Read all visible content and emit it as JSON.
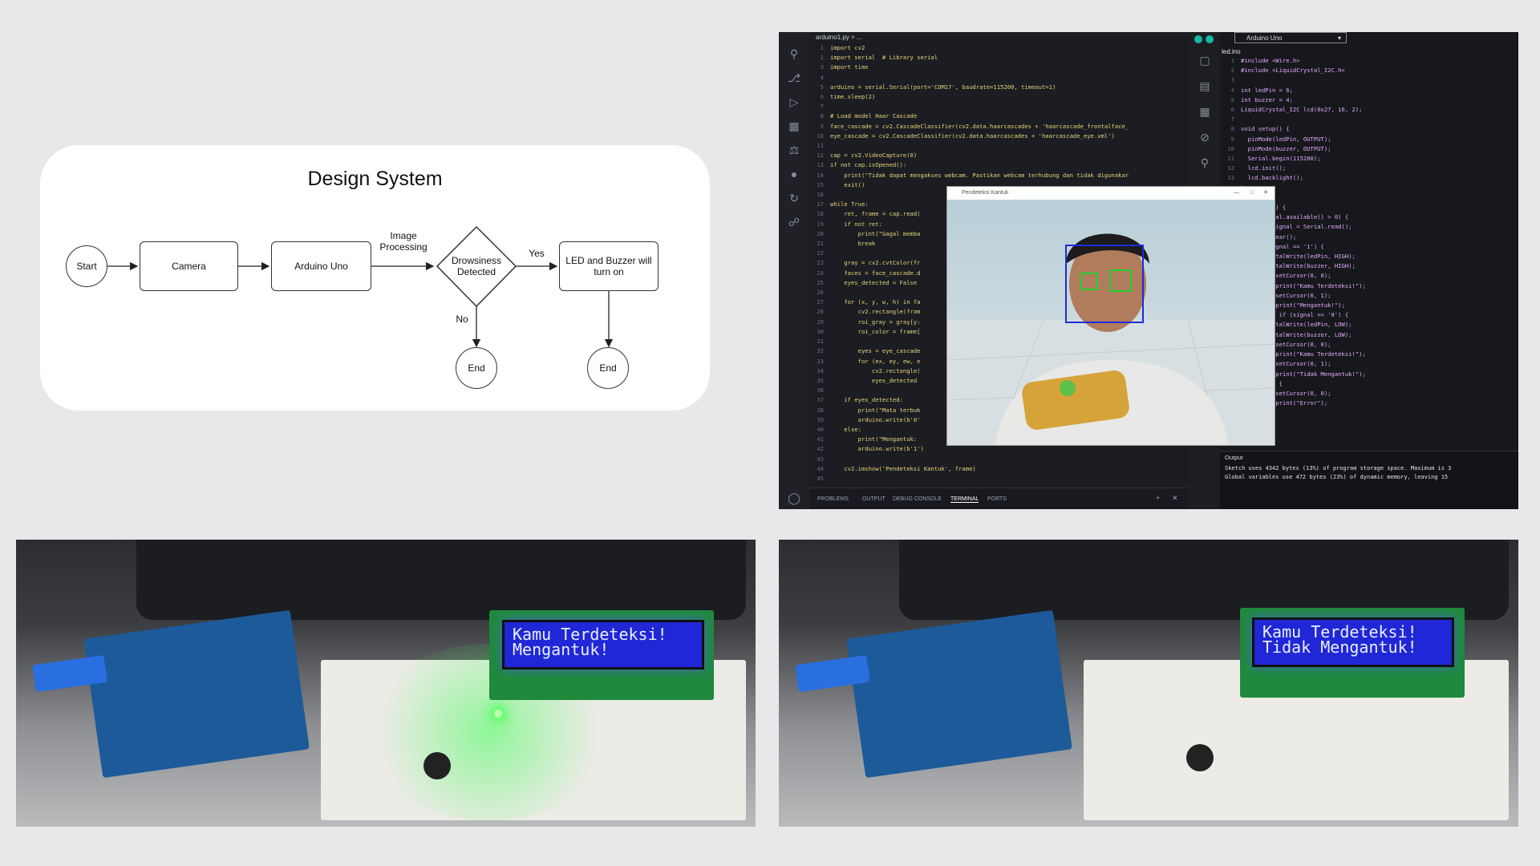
{
  "design": {
    "title": "Design System",
    "nodes": {
      "start": "Start",
      "camera": "Camera",
      "arduino": "Arduino Uno",
      "decision": "Drowsiness Detected",
      "action": "LED and Buzzer will turn on",
      "end1": "End",
      "end2": "End"
    },
    "labels": {
      "image_processing": "Image Processing",
      "yes": "Yes",
      "no": "No"
    }
  },
  "ide": {
    "python_tab": "arduino1.py > ...",
    "python_code": [
      "import cv2",
      "import serial  # Library serial",
      "import time",
      "",
      "arduino = serial.Serial(port='COM17', baudrate=115200, timeout=1)",
      "time.sleep(2)",
      "",
      "# Load model Haar Cascade",
      "face_cascade = cv2.CascadeClassifier(cv2.data.haarcascades + 'haarcascade_frontalface_",
      "eye_cascade = cv2.CascadeClassifier(cv2.data.haarcascades + 'haarcascade_eye.xml')",
      "",
      "cap = cv2.VideoCapture(0)",
      "if not cap.isOpened():",
      "    print(\"Tidak dapat mengakses webcam. Pastikan webcam terhubung dan tidak digunakar",
      "    exit()",
      "",
      "while True:",
      "    ret, frame = cap.read(",
      "    if not ret:",
      "        print(\"Gagal memba",
      "        break",
      "",
      "    gray = cv2.cvtColor(fr",
      "    faces = face_cascade.d",
      "    eyes_detected = False",
      "",
      "    for (x, y, w, h) in fa",
      "        cv2.rectangle(fram",
      "        roi_gray = gray[y:",
      "        roi_color = frame[",
      "",
      "        eyes = eye_cascade",
      "        for (ex, ey, ew, e",
      "            cv2.rectangle(",
      "            eyes_detected",
      "",
      "    if eyes_detected:",
      "        print(\"Mata terbuk",
      "        arduino.write(b'0'",
      "    else:",
      "        print(\"Mengantuk:",
      "        arduino.write(b'1')",
      "",
      "    cv2.imshow('Pendeteksi Kantuk', frame)",
      ""
    ],
    "bottom_tabs": [
      "PROBLEMS",
      "OUTPUT",
      "DEBUG CONSOLE",
      "TERMINAL",
      "PORTS"
    ],
    "board_select": "Arduino Uno",
    "ino_tab": "led.ino",
    "ino_code": [
      "#include <Wire.h>",
      "#include <LiquidCrystal_I2C.h>",
      "",
      "int ledPin = 6;",
      "int buzzer = 4;",
      "LiquidCrystal_I2C lcd(0x27, 16, 2);",
      "",
      "void setup() {",
      "  pinMode(ledPin, OUTPUT);",
      "  pinMode(buzzer, OUTPUT);",
      "  Serial.begin(115200);",
      "  lcd.init();",
      "  lcd.backlight();",
      "}",
      "",
      "void loop() {",
      "  if (Serial.available() > 0) {",
      "    char signal = Serial.read();",
      "    lcd.clear();",
      "    if (signal == '1') {",
      "      digitalWrite(ledPin, HIGH);",
      "      digitalWrite(buzzer, HIGH);",
      "      lcd.setCursor(0, 0);",
      "      lcd.print(\"Kamu Terdeteksi!\");",
      "      lcd.setCursor(0, 1);",
      "      lcd.print(\"Mengantuk!\");",
      "    } else if (signal == '0') {",
      "      digitalWrite(ledPin, LOW);",
      "      digitalWrite(buzzer, LOW);",
      "      lcd.setCursor(0, 0);",
      "      lcd.print(\"Kamu Terdeteksi!\");",
      "      lcd.setCursor(0, 1);",
      "      lcd.print(\"Tidak Mengantuk!\");",
      "    } else {",
      "      lcd.setCursor(0, 0);",
      "      lcd.print(\"Error\");",
      "    }",
      "  }",
      "}"
    ],
    "output_title": "Output",
    "output_lines": [
      "Sketch uses 4342 bytes (13%) of program storage space. Maximum is 3",
      "Global variables use 472 bytes (23%) of dynamic memory, leaving 15"
    ],
    "webcam_title": "Pendeteksi Kantuk"
  },
  "photos": {
    "left_lcd": [
      "Kamu Terdeteksi!",
      "Mengantuk!"
    ],
    "right_lcd": [
      "Kamu Terdeteksi!",
      "Tidak Mengantuk!"
    ]
  }
}
